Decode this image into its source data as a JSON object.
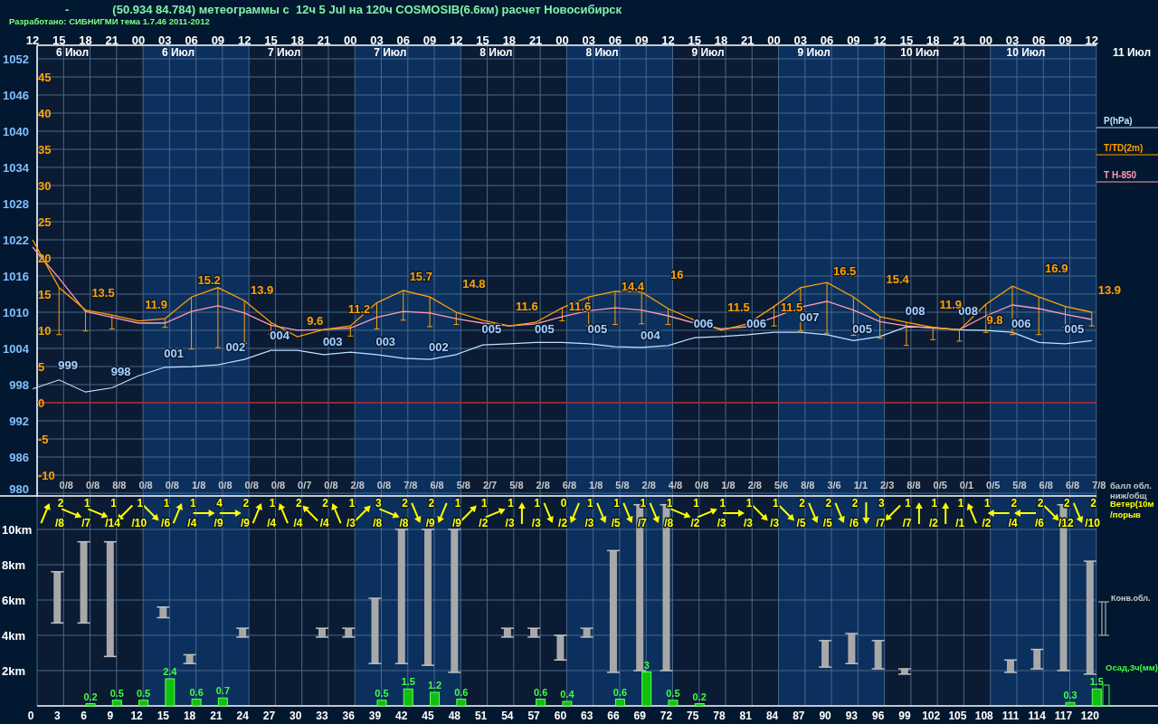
{
  "header": {
    "marker": "-",
    "title": "(50.934 84.784) метеограммы с  12ч 5 Jul на 120ч COSMOSIB(6.6км) расчет Новосибирск",
    "credit": "Разработано: СИБНИГМИ тема 1.7.46 2011-2012"
  },
  "days": [
    "6 Июл",
    "6 Июл",
    "7 Июл",
    "7 Июл",
    "8 Июл",
    "8 Июл",
    "9 Июл",
    "9 Июл",
    "10 Июл",
    "10 Июл",
    "11 Июл"
  ],
  "pressure_chart": {
    "chart_data": {
      "type": "line",
      "categories": [
        "12",
        "15",
        "18",
        "21",
        "00",
        "03",
        "06",
        "09",
        "12",
        "15",
        "18",
        "21",
        "00",
        "03",
        "06",
        "09",
        "12",
        "15",
        "18",
        "21",
        "00",
        "03",
        "06",
        "09",
        "12",
        "15",
        "18",
        "21",
        "00",
        "03",
        "06",
        "09",
        "12",
        "15",
        "18",
        "21",
        "00",
        "03",
        "06",
        "09",
        "12"
      ],
      "series": [
        {
          "name": "P(hPa)",
          "color": "#c0e0ff",
          "values": [
            997.3,
            998.8,
            996.8,
            997.5,
            999.5,
            1000.9,
            1001,
            1001.3,
            1002.2,
            1003.7,
            1003.7,
            1003,
            1003.4,
            1003,
            1002.4,
            1002.2,
            1003,
            1004.6,
            1004.8,
            1005,
            1005,
            1004.8,
            1004.3,
            1004.2,
            1004.5,
            1005.8,
            1006,
            1006.3,
            1006.7,
            1006.7,
            1006.3,
            1005.3,
            1006,
            1007.6,
            1007.5,
            1007.1,
            1007,
            1006.7,
            1005,
            1004.8,
            1005.3
          ]
        }
      ],
      "ylim": [
        979.6,
        1054.2
      ],
      "yticks": [
        1052,
        1046,
        1040,
        1034,
        1028,
        1022,
        1016,
        1010,
        1004,
        998,
        992,
        986,
        980
      ]
    }
  },
  "temperature_chart": {
    "chart_data": {
      "type": "line",
      "series": [
        {
          "name": "T/TD(2m)",
          "color": "#ffa000",
          "values": [
            22.5,
            15.9,
            12.8,
            12.1,
            11.3,
            11.6,
            14.6,
            15.9,
            14.1,
            11.1,
            9.1,
            10.1,
            10.6,
            13.8,
            15.5,
            14.6,
            12.5,
            11.4,
            10.6,
            11.1,
            13.1,
            14.6,
            15.4,
            15.3,
            13,
            11.4,
            10,
            10.9,
            13.3,
            15.9,
            16.6,
            14.6,
            11.9,
            11.1,
            10.4,
            10,
            13.6,
            16.1,
            14.6,
            13.3,
            12.5
          ]
        },
        {
          "name": "T H-850",
          "color": "#ff9ab0",
          "values": [
            21.5,
            17.2,
            12.6,
            11.8,
            11,
            11,
            12.6,
            13.4,
            12.4,
            10.7,
            10,
            10.1,
            10.3,
            11.8,
            12.6,
            12.4,
            11.6,
            11,
            10.6,
            10.9,
            11.9,
            12.7,
            13.1,
            12.8,
            12,
            11,
            10.2,
            10.5,
            11.8,
            13.2,
            14,
            12.8,
            11.2,
            10.6,
            10.3,
            10.1,
            12,
            13.5,
            13,
            12.2,
            11.5
          ]
        }
      ],
      "ylim": [
        -12.9,
        49.4
      ],
      "yticks": [
        45,
        40,
        35,
        30,
        25,
        20,
        15,
        10,
        5,
        0,
        -5,
        -10
      ]
    }
  },
  "pressure_labels": [
    "999",
    "998",
    "001",
    "002",
    "004",
    "003",
    "003",
    "002",
    "005",
    "005",
    "005",
    "004",
    "006",
    "006",
    "007",
    "005",
    "008",
    "008",
    "006",
    "005"
  ],
  "temperature_labels": [
    "13.5",
    "11.9",
    "15.2",
    "13.9",
    "9.6",
    "11.2",
    "15.7",
    "14.8",
    "11.6",
    "11.6",
    "14.4",
    "16",
    "11.5",
    "11.5",
    "16.5",
    "15.4",
    "11.9",
    "9.8",
    "16.9",
    "13.9"
  ],
  "cloud_fraction": [
    "0/8",
    "0/8",
    "8/8",
    "0/8",
    "0/8",
    "1/8",
    "0/8",
    "0/8",
    "0/8",
    "0/7",
    "0/8",
    "2/8",
    "0/8",
    "7/8",
    "6/8",
    "5/8",
    "2/7",
    "5/8",
    "2/8",
    "6/8",
    "1/8",
    "5/8",
    "2/8",
    "4/8",
    "0/8",
    "1/8",
    "2/8",
    "5/6",
    "8/8",
    "3/6",
    "1/1",
    "2/3",
    "8/8",
    "0/5",
    "0/1",
    "0/5",
    "5/8",
    "6/8",
    "6/8",
    "7/8"
  ],
  "wind": [
    {
      "speed": "2",
      "gust": "/8",
      "kind": "nne"
    },
    {
      "speed": "1",
      "gust": "/7",
      "kind": "ese"
    },
    {
      "speed": "1",
      "gust": "/14",
      "kind": "ese"
    },
    {
      "speed": "1",
      "gust": "/10",
      "kind": "sw"
    },
    {
      "speed": "1",
      "gust": "/6",
      "kind": "se"
    },
    {
      "speed": "1",
      "gust": "/4",
      "kind": "nne"
    },
    {
      "speed": "4",
      "gust": "/9",
      "kind": "e"
    },
    {
      "speed": "2",
      "gust": "/9",
      "kind": "e"
    },
    {
      "speed": "1",
      "gust": "/4",
      "kind": "nne"
    },
    {
      "speed": "2",
      "gust": "/4",
      "kind": "nnw"
    },
    {
      "speed": "2",
      "gust": "/4",
      "kind": "nw"
    },
    {
      "speed": "1",
      "gust": "/3",
      "kind": "nnw"
    },
    {
      "speed": "3",
      "gust": "/8",
      "kind": "ne"
    },
    {
      "speed": "2",
      "gust": "/8",
      "kind": "ese"
    },
    {
      "speed": "2",
      "gust": "/9",
      "kind": "sse"
    },
    {
      "speed": "1",
      "gust": "/9",
      "kind": "ssw"
    },
    {
      "speed": "1",
      "gust": "/2",
      "kind": "ne"
    },
    {
      "speed": "1",
      "gust": "/3",
      "kind": "ene"
    },
    {
      "speed": "1",
      "gust": "/3",
      "kind": "n"
    },
    {
      "speed": "0",
      "gust": "/2",
      "kind": "sse"
    },
    {
      "speed": "1",
      "gust": "/3",
      "kind": "ssw"
    },
    {
      "speed": "1",
      "gust": "/5",
      "kind": "sse"
    },
    {
      "speed": "1",
      "gust": "/7",
      "kind": "sse"
    },
    {
      "speed": "1",
      "gust": "/8",
      "kind": "sse"
    },
    {
      "speed": "1",
      "gust": "/2",
      "kind": "ese"
    },
    {
      "speed": "1",
      "gust": "/3",
      "kind": "ene"
    },
    {
      "speed": "1",
      "gust": "/3",
      "kind": "e"
    },
    {
      "speed": "1",
      "gust": "/3",
      "kind": "se"
    },
    {
      "speed": "2",
      "gust": "/5",
      "kind": "se"
    },
    {
      "speed": "2",
      "gust": "/5",
      "kind": "sse"
    },
    {
      "speed": "2",
      "gust": "/6",
      "kind": "sse"
    },
    {
      "speed": "3",
      "gust": "/7",
      "kind": "s"
    },
    {
      "speed": "1",
      "gust": "/7",
      "kind": "sw"
    },
    {
      "speed": "1",
      "gust": "/2",
      "kind": "n"
    },
    {
      "speed": "1",
      "gust": "/1",
      "kind": "n"
    },
    {
      "speed": "1",
      "gust": "/2",
      "kind": "nnw"
    },
    {
      "speed": "2",
      "gust": "/4",
      "kind": "w"
    },
    {
      "speed": "2",
      "gust": "/6",
      "kind": "w"
    },
    {
      "speed": "2",
      "gust": "/12",
      "kind": "se"
    },
    {
      "speed": "2",
      "gust": "/10",
      "kind": "sse"
    }
  ],
  "height_axis": [
    "10km",
    "8km",
    "6km",
    "4km",
    "2km"
  ],
  "hour_offsets": [
    "0",
    "3",
    "6",
    "9",
    "12",
    "15",
    "18",
    "21",
    "24",
    "27",
    "30",
    "33",
    "36",
    "39",
    "42",
    "45",
    "48",
    "51",
    "54",
    "57",
    "60",
    "63",
    "66",
    "69",
    "72",
    "75",
    "78",
    "81",
    "84",
    "87",
    "90",
    "93",
    "96",
    "99",
    "102",
    "105",
    "108",
    "111",
    "114",
    "117",
    "120"
  ],
  "precipitation_labels": [
    "0.2",
    "0.5",
    "0.5",
    "2.4",
    "0.6",
    "0.7",
    "0.5",
    "1.5",
    "1.2",
    "0.6",
    "0.6",
    "0.4",
    "0.6",
    "3",
    "0.5",
    "0.2",
    "0.3",
    "1.5"
  ],
  "legend": [
    {
      "kind": "text",
      "label": "балл обл.",
      "color": "#c8c8c8"
    },
    {
      "kind": "text",
      "label": "ниж/общ",
      "color": "#c8c8c8"
    },
    {
      "kind": "text",
      "label": "Ветер(10м",
      "color": "#ffff00"
    },
    {
      "kind": "text",
      "label": "/порыв",
      "color": "#ffff00"
    },
    {
      "kind": "ibar",
      "label": "Конв.обл.",
      "color": "#c8c8c8"
    },
    {
      "kind": "hollow-bar",
      "label": "Осад,3ч(мм)",
      "color": "#40ff40"
    }
  ]
}
